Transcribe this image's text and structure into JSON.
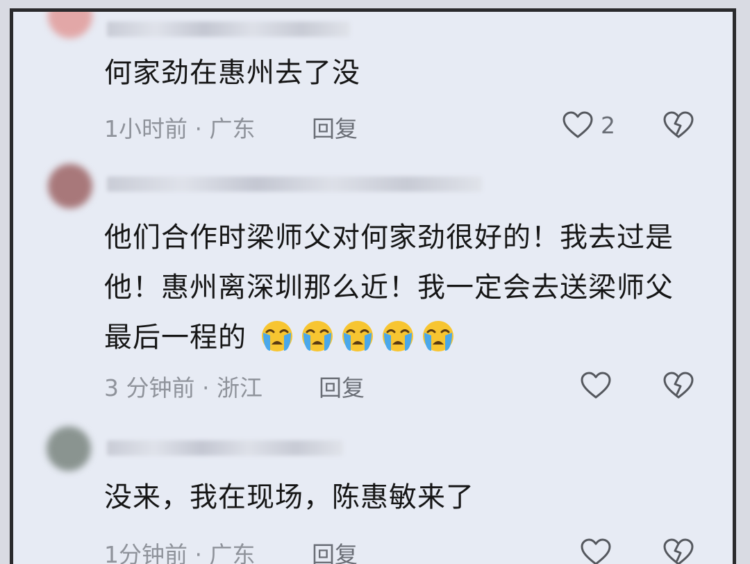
{
  "comments": [
    {
      "text": "何家劲在惠州去了没",
      "time": "1小时前",
      "separator": "·",
      "location": "广东",
      "reply_label": "回复",
      "like_count": "2",
      "avatar_color": "#e2a7a7"
    },
    {
      "text": "他们合作时梁师父对何家劲很好的！我去过是他！惠州离深圳那么近！我一定会去送梁师父最后一程的",
      "emoji_count": 5,
      "emoji_name": "loudly-crying-face",
      "time": "3 分钟前",
      "separator": "·",
      "location": "浙江",
      "reply_label": "回复",
      "like_count": "",
      "avatar_color": "#a8787a"
    },
    {
      "text": "没来，我在现场，陈惠敏来了",
      "time": "1分钟前",
      "separator": "·",
      "location": "广东",
      "reply_label": "回复",
      "like_count": "",
      "avatar_color": "#8a9490"
    }
  ],
  "icons": {
    "like": "heart-outline-icon",
    "dislike": "broken-heart-icon"
  },
  "colors": {
    "background": "#e7ebf4",
    "frame_border": "#2a2a2c",
    "text": "#161616",
    "meta": "#8f939b",
    "icon_stroke": "#55585e"
  }
}
